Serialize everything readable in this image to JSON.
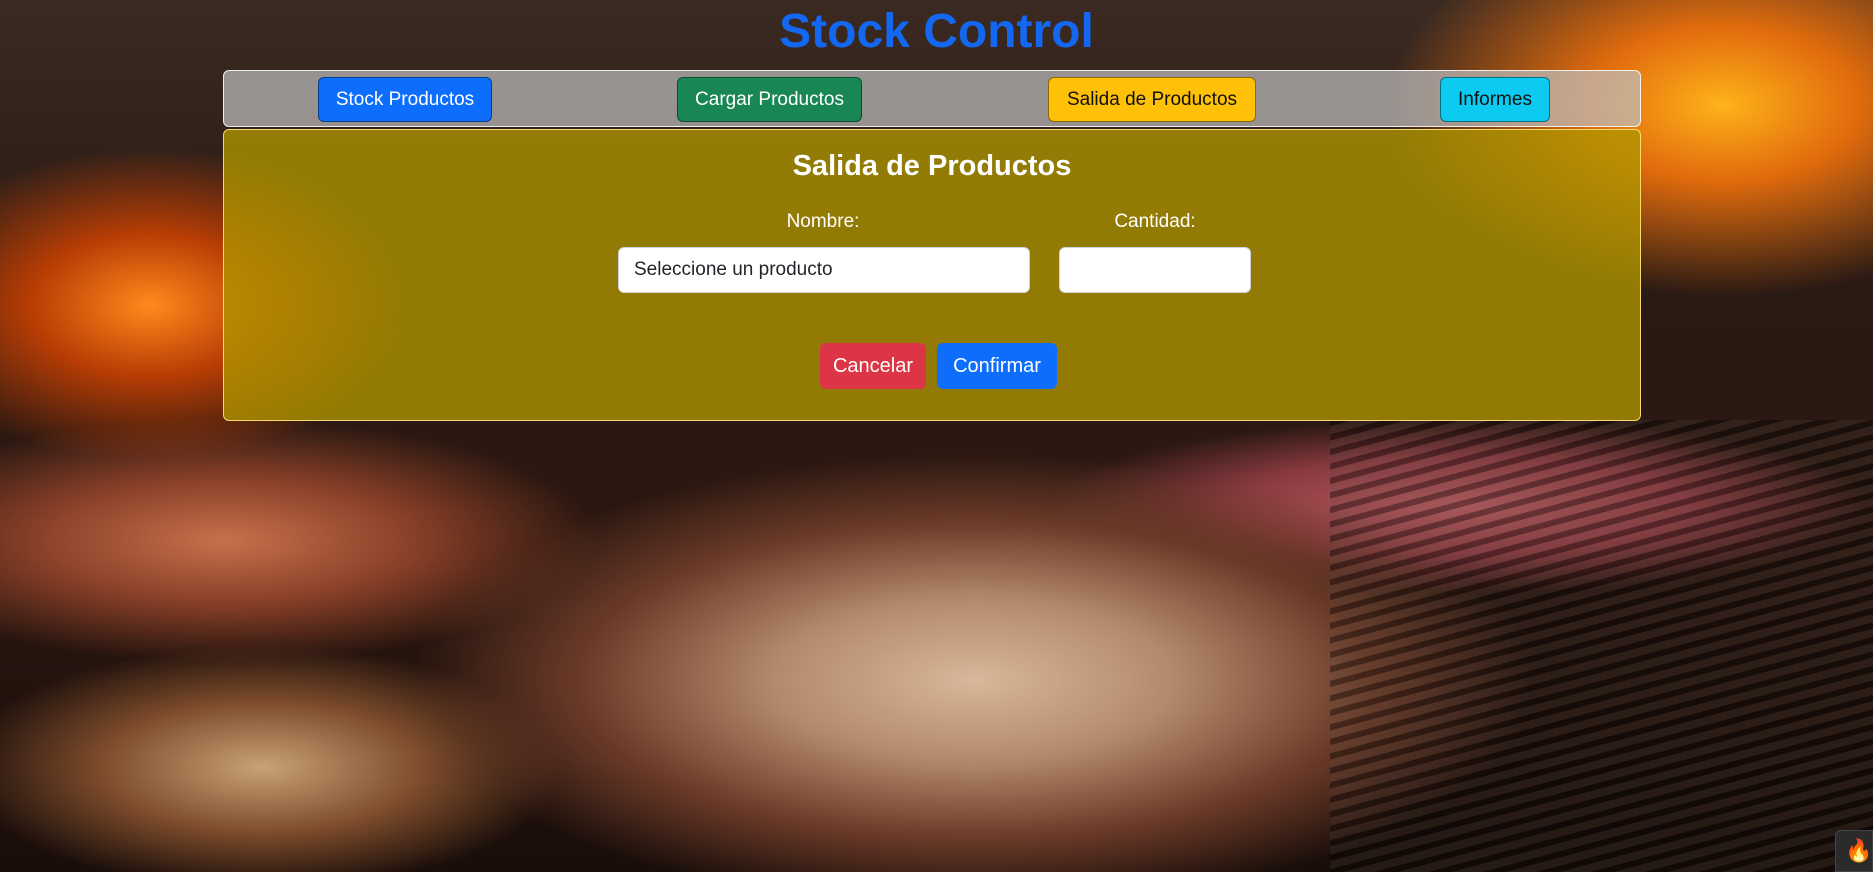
{
  "app": {
    "title": "Stock Control"
  },
  "nav": {
    "items": [
      {
        "label": "Stock Productos"
      },
      {
        "label": "Cargar Productos"
      },
      {
        "label": "Salida de Productos"
      },
      {
        "label": "Informes"
      }
    ]
  },
  "form": {
    "title": "Salida de Productos",
    "nombre_label": "Nombre:",
    "nombre_value": "Seleccione un producto",
    "cantidad_label": "Cantidad:",
    "cantidad_value": "",
    "cancel_label": "Cancelar",
    "confirm_label": "Confirmar"
  },
  "colors": {
    "title": "#1467f0",
    "primary": "#0d6efd",
    "success": "#198754",
    "warning": "#ffc107",
    "info": "#0dcaf0",
    "danger": "#dc3545"
  },
  "icons": {
    "corner_widget": "flame-icon"
  }
}
